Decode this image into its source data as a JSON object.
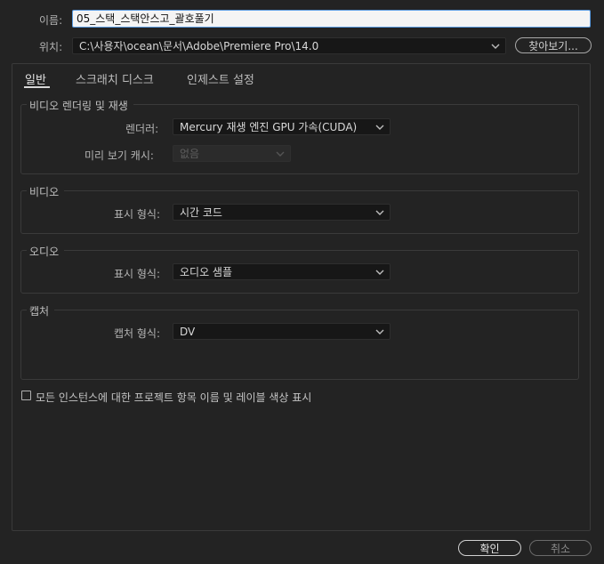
{
  "header": {
    "name_label": "이름:",
    "name_value": "05_스택_스택안스고_괄호풀기",
    "location_label": "위치:",
    "location_value": "C:\\사용자\\ocean\\문서\\Adobe\\Premiere Pro\\14.0",
    "browse_label": "찾아보기..."
  },
  "tabs": [
    {
      "label": "일반"
    },
    {
      "label": "스크래치 디스크"
    },
    {
      "label": "인제스트 설정"
    }
  ],
  "video_rendering": {
    "title": "비디오 렌더링 및 재생",
    "renderer_label": "렌더러:",
    "renderer_value": "Mercury 재생 엔진 GPU 가속(CUDA)",
    "preview_cache_label": "미리 보기 캐시:",
    "preview_cache_value": "없음"
  },
  "video": {
    "title": "비디오",
    "display_format_label": "표시 형식:",
    "display_format_value": "시간 코드"
  },
  "audio": {
    "title": "오디오",
    "display_format_label": "표시 형식:",
    "display_format_value": "오디오 샘플"
  },
  "capture": {
    "title": "캡처",
    "format_label": "캡처 형식:",
    "format_value": "DV"
  },
  "checkbox": {
    "label": "모든 인스턴스에 대한 프로젝트 항목 이름 및 레이블 색상 표시",
    "checked": false
  },
  "footer": {
    "ok_label": "확인",
    "cancel_label": "취소"
  }
}
